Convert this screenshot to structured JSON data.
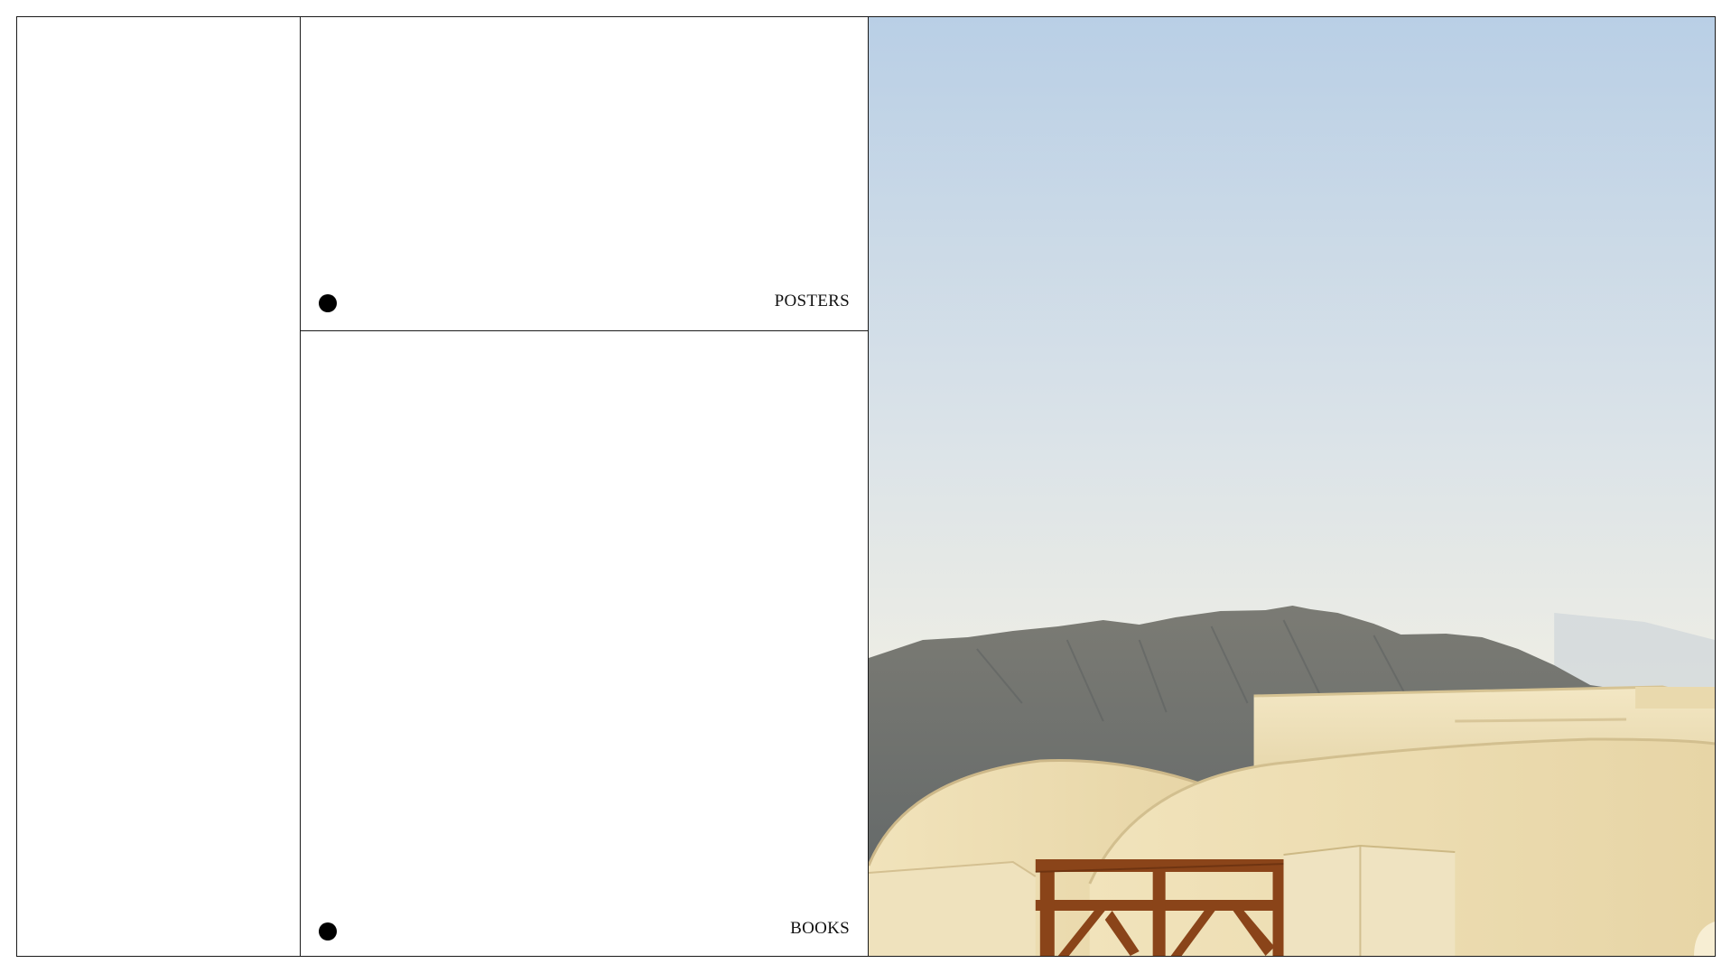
{
  "grid": {
    "cells": [
      {
        "label": "POSTERS"
      },
      {
        "label": "BOOKS"
      }
    ]
  },
  "photo": {
    "subject": "santorini-rooftops-mountain-photo",
    "colors": {
      "sky_top": "#b9cfe6",
      "sky_bottom": "#f1efe4",
      "mountain": "#6d6f6e",
      "walls": "#efe3bf",
      "railing": "#8a4419"
    }
  }
}
